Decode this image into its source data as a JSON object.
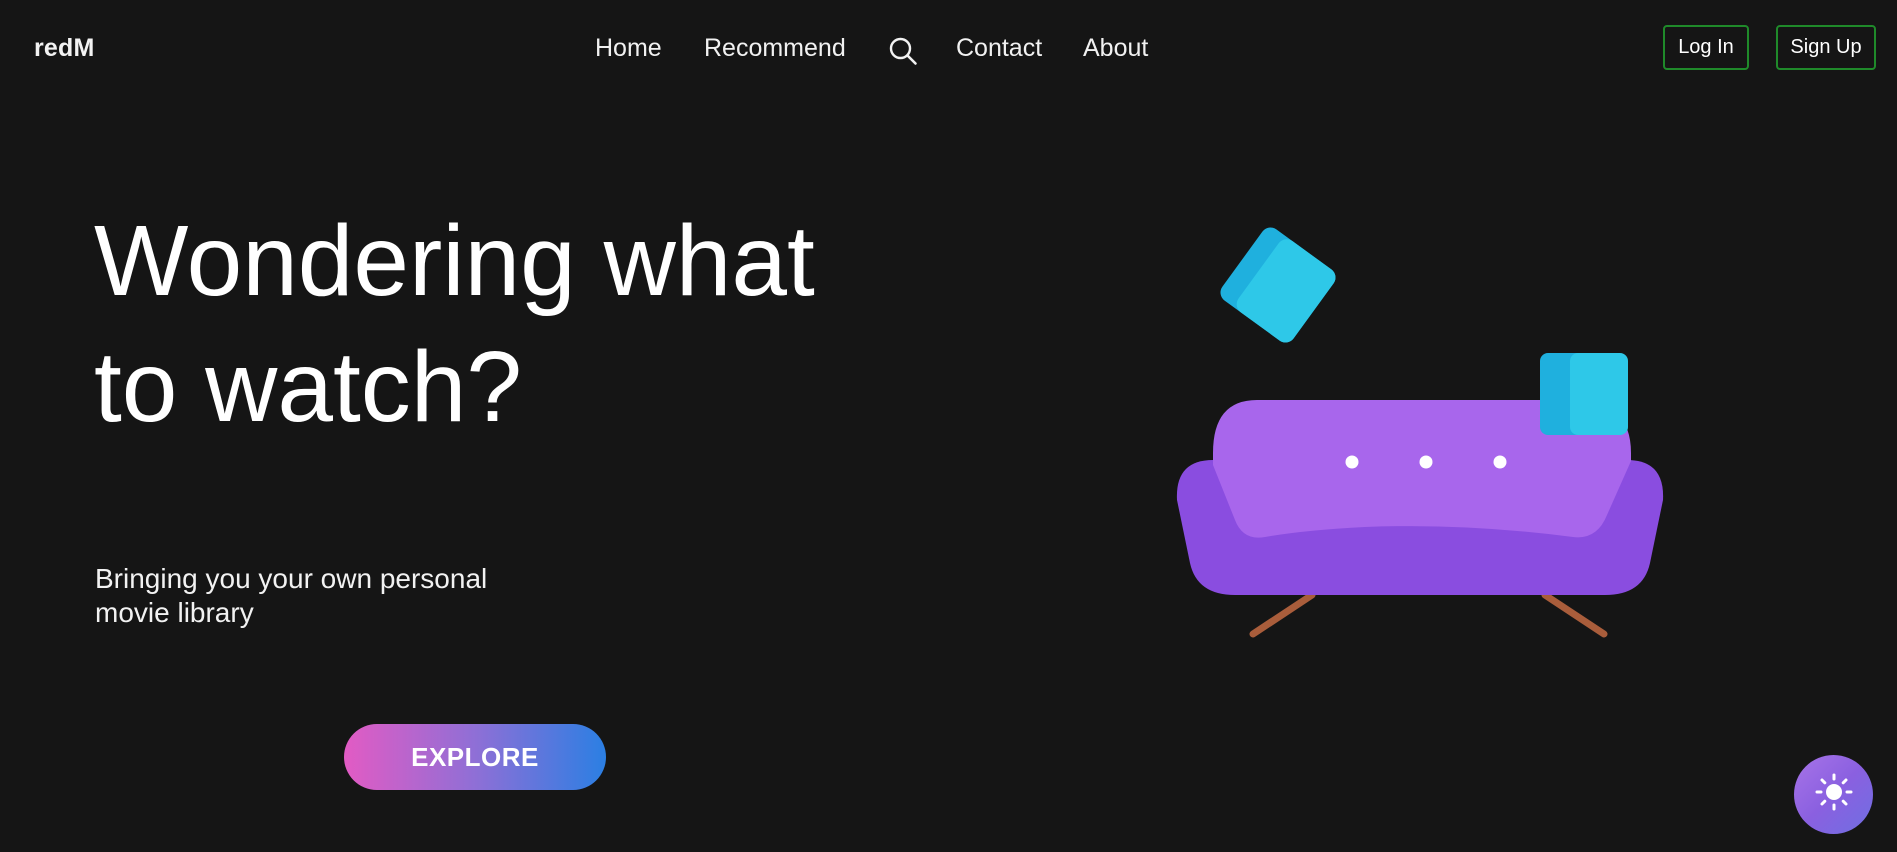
{
  "header": {
    "logo": "redM",
    "nav": [
      {
        "label": "Home"
      },
      {
        "label": "Recommend"
      },
      {
        "label": "Contact"
      },
      {
        "label": "About"
      }
    ],
    "search_icon": "search-icon",
    "login_label": "Log In",
    "signup_label": "Sign Up"
  },
  "hero": {
    "title_line1": "Wondering what",
    "title_line2": "to watch?",
    "subtitle_line1": "Bringing you your own personal",
    "subtitle_line2": "movie library",
    "explore_label": "EXPLORE"
  },
  "illustration": {
    "name": "sofa-illustration",
    "sofa_color": "#8a4de0",
    "sofa_back_color": "#a866ec",
    "cushion_color": "#2ec8e8",
    "leg_color": "#a95d3b"
  },
  "theme_toggle": {
    "icon": "sun-icon"
  },
  "colors": {
    "background": "#151515",
    "button_border": "#1f8a2a",
    "explore_gradient_start": "#e25bc4",
    "explore_gradient_end": "#2b7fe3"
  }
}
